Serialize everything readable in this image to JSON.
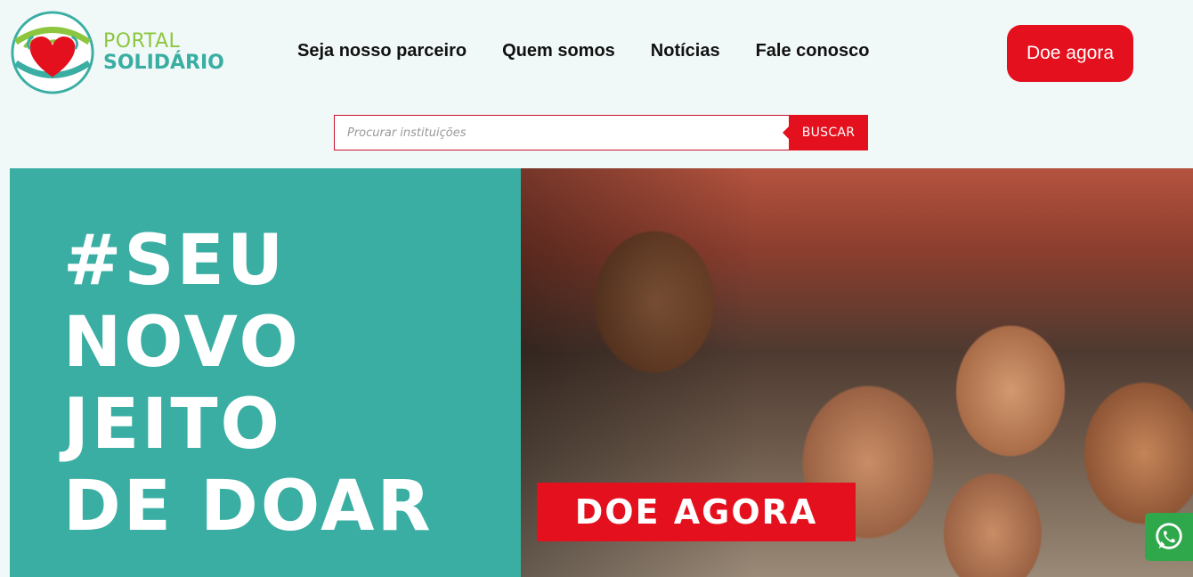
{
  "brand": {
    "line1": "PORTAL",
    "line2": "SOLIDÁRIO",
    "colors": {
      "green": "#8cc63f",
      "teal": "#3aaea3",
      "heart": "#e4101e"
    }
  },
  "nav": {
    "items": [
      {
        "label": "Seja nosso parceiro"
      },
      {
        "label": "Quem somos"
      },
      {
        "label": "Notícias"
      },
      {
        "label": "Fale conosco"
      }
    ],
    "donate_label": "Doe agora"
  },
  "search": {
    "placeholder": "Procurar instituições",
    "value": "",
    "button_label": "BUSCAR"
  },
  "hero": {
    "headline": [
      "#SEU",
      "NOVO",
      "JEITO",
      "DE DOAR"
    ],
    "cta_label": "DOE AGORA",
    "photo_icon": "children-smiling-photo",
    "background_color": "#3aaea3"
  },
  "floating": {
    "whatsapp_icon": "whatsapp-icon",
    "color": "#2ea84b"
  },
  "colors": {
    "accent": "#e4101e",
    "page_background": "#f1f9f8"
  }
}
